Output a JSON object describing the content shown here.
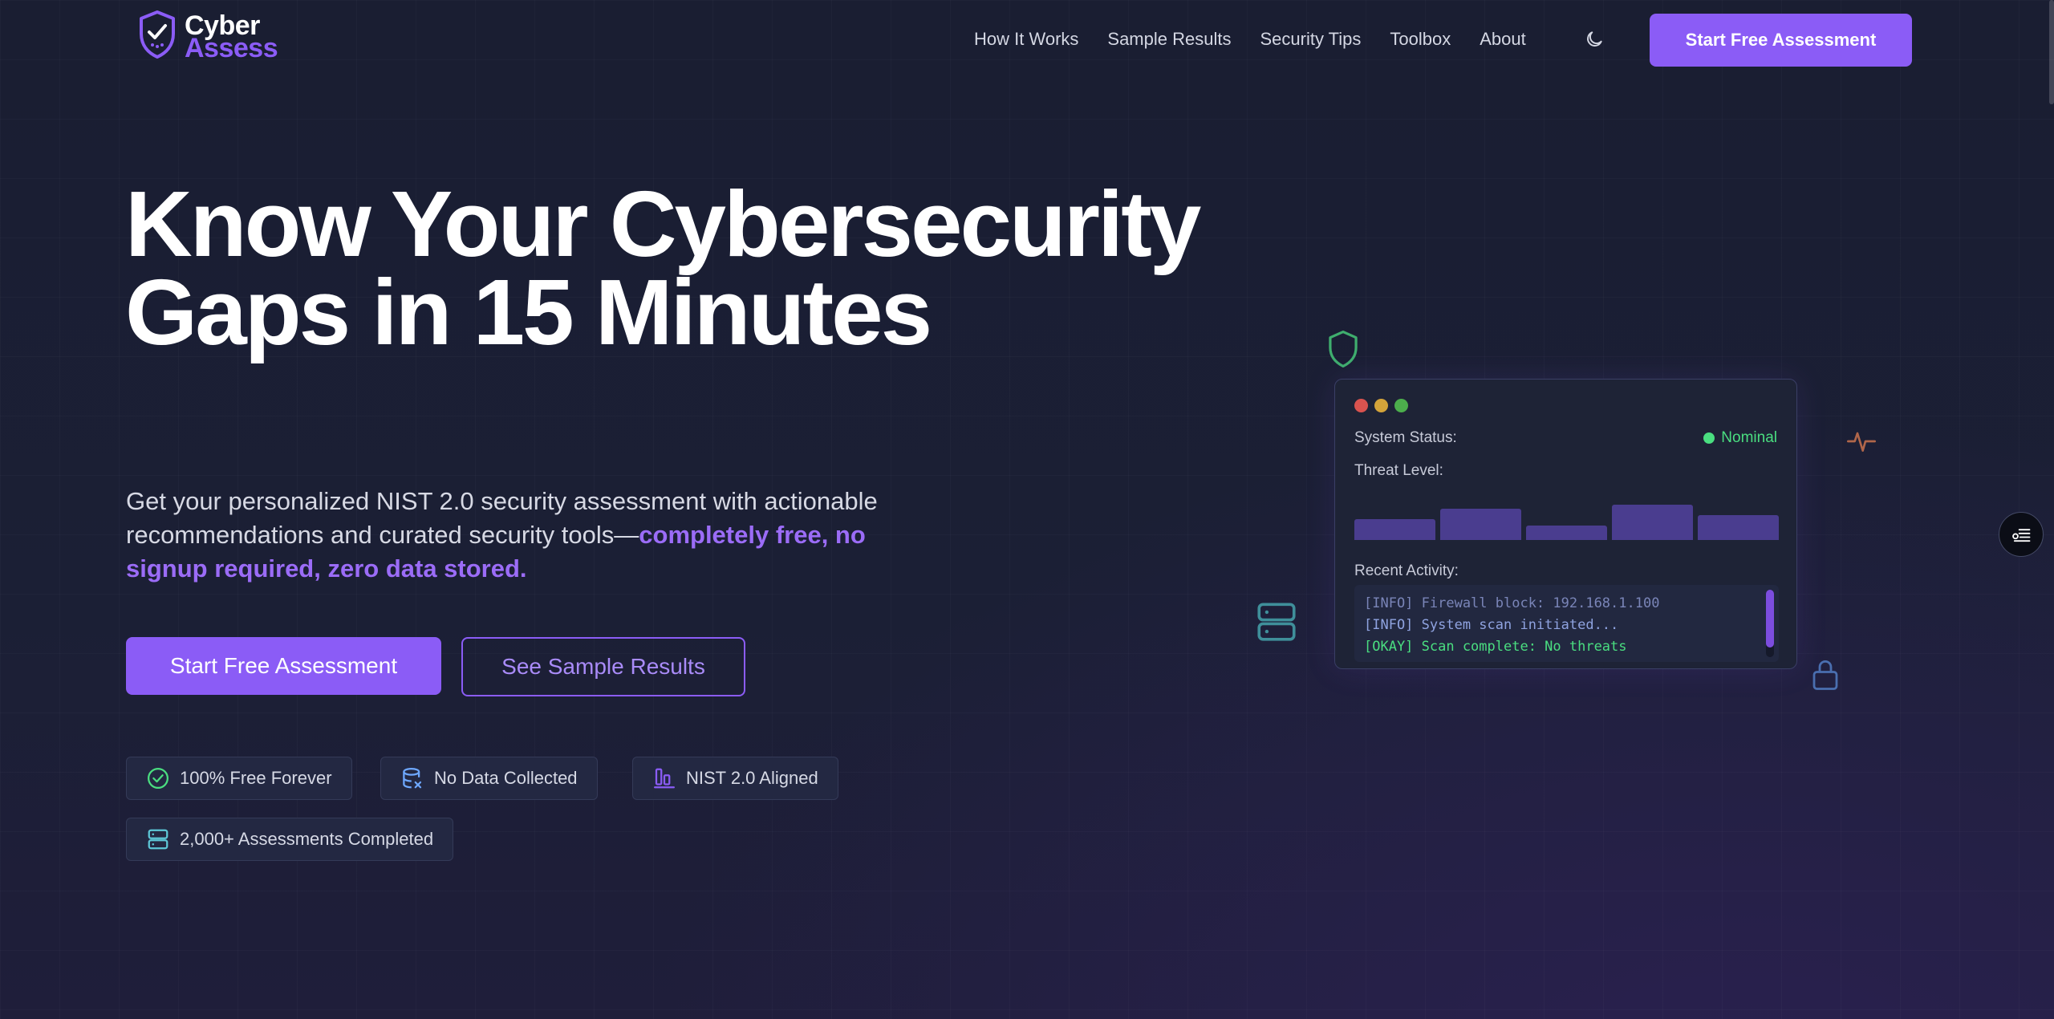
{
  "brand": {
    "line1": "Cyber",
    "line2": "Assess",
    "accent": "#8b5cf6"
  },
  "nav": {
    "items": [
      "How It Works",
      "Sample Results",
      "Security Tips",
      "Toolbox",
      "About"
    ],
    "theme_toggle_icon": "moon-icon",
    "cta_label": "Start Free Assessment"
  },
  "hero": {
    "title": "Know Your Cybersecurity Gaps in 15 Minutes",
    "subtitle_plain": "Get your personalized NIST 2.0 security assessment with actionable recommendations and curated security tools—",
    "subtitle_highlight": "completely free, no signup required, zero data stored.",
    "primary_button": "Start Free Assessment",
    "secondary_button": "See Sample Results"
  },
  "badges": [
    {
      "label": "100% Free Forever",
      "icon": "check-circle-icon",
      "color": "#4ade80"
    },
    {
      "label": "No Data Collected",
      "icon": "database-icon",
      "color": "#6ea8ff"
    },
    {
      "label": "NIST 2.0 Aligned",
      "icon": "bar-chart-icon",
      "color": "#8b5cf6"
    },
    {
      "label": "2,000+ Assessments Completed",
      "icon": "server-icon",
      "color": "#5ec8d8"
    }
  ],
  "dashboard": {
    "status_label": "System Status:",
    "status_value": "Nominal",
    "threat_label": "Threat Level:",
    "threat_levels": [
      0.52,
      0.78,
      0.36,
      0.88,
      0.62
    ],
    "activity_label": "Recent Activity:",
    "log_lines": [
      "[INFO] Firewall block: 192.168.1.100",
      "[INFO] System scan initiated...",
      "[OKAY] Scan complete: No threats"
    ]
  }
}
